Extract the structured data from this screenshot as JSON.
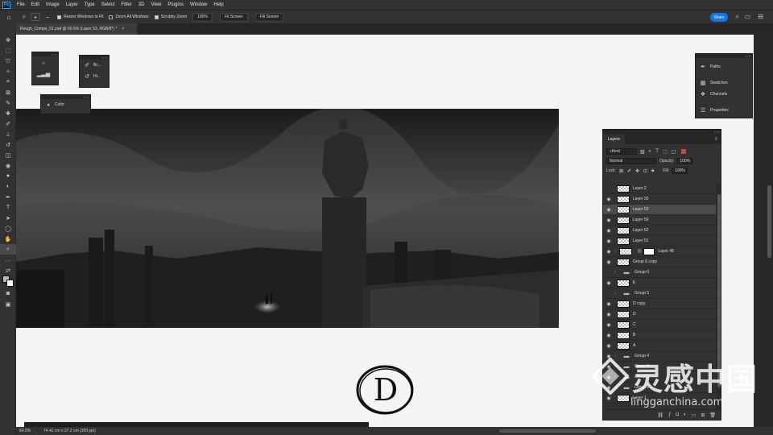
{
  "app": {
    "logo": "Ps"
  },
  "menu": [
    "File",
    "Edit",
    "Image",
    "Layer",
    "Type",
    "Select",
    "Filter",
    "3D",
    "View",
    "Plugins",
    "Window",
    "Help"
  ],
  "options_bar": {
    "resize_windows": "Resize Windows to Fit",
    "zoom_all": "Zoom All Windows",
    "scrubby_zoom": "Scrubby Zoom",
    "zoom_100": "100%",
    "fit_screen": "Fit Screen",
    "fill_screen": "Fill Screen",
    "share": "Share"
  },
  "document_tab": {
    "title": "Rough_Comps_01.psd @ 60.5% (Layer 53, RGB/8*) *",
    "close": "×"
  },
  "panels": {
    "brush_mini": {
      "row1": "Br...",
      "row2": "Hi..."
    },
    "color": {
      "label": "Color"
    },
    "dock": {
      "paths": "Paths",
      "swatches": "Swatches",
      "channels": "Channels",
      "properties": "Properties"
    }
  },
  "layers_panel": {
    "tab": "Layers",
    "filter_kind": "Kind",
    "blend_mode": "Normal",
    "opacity_label": "Opacity:",
    "opacity": "100%",
    "lock_label": "Lock:",
    "fill_label": "Fill:",
    "fill": "100%",
    "layers": [
      {
        "name": "Layer 2",
        "type": "layer",
        "visible": false
      },
      {
        "name": "Layer 30",
        "type": "layer",
        "visible": true
      },
      {
        "name": "Layer 53",
        "type": "layer",
        "visible": true,
        "selected": true
      },
      {
        "name": "Layer 50",
        "type": "layer",
        "visible": true
      },
      {
        "name": "Layer 52",
        "type": "layer",
        "visible": true
      },
      {
        "name": "Layer 51",
        "type": "layer",
        "visible": true
      },
      {
        "name": "Layer 48",
        "type": "masked",
        "visible": true
      },
      {
        "name": "Group 6 copy",
        "type": "layer",
        "visible": true
      },
      {
        "name": "Group 6",
        "type": "group",
        "visible": false
      },
      {
        "name": "E",
        "type": "layer",
        "visible": true
      },
      {
        "name": "Group 5",
        "type": "group",
        "visible": false
      },
      {
        "name": "D copy",
        "type": "layer",
        "visible": true
      },
      {
        "name": "D",
        "type": "layer",
        "visible": true
      },
      {
        "name": "C",
        "type": "layer",
        "visible": true
      },
      {
        "name": "B",
        "type": "layer",
        "visible": true
      },
      {
        "name": "A",
        "type": "layer",
        "visible": true
      },
      {
        "name": "Group 4",
        "type": "group",
        "visible": true
      },
      {
        "name": "Group 3",
        "type": "group",
        "visible": true
      },
      {
        "name": "Group 2",
        "type": "group",
        "visible": true
      },
      {
        "name": "Group 1",
        "type": "group",
        "visible": true
      },
      {
        "name": "Layer 1",
        "type": "layer",
        "visible": true
      }
    ]
  },
  "canvas": {
    "sketch_letter": "D"
  },
  "status_bar": {
    "zoom": "60.5%",
    "dims": "74.42 cm x 37.2 cm (300 ppi)"
  },
  "watermark": {
    "cn": "灵感中国",
    "url": "lingganchina.com"
  }
}
